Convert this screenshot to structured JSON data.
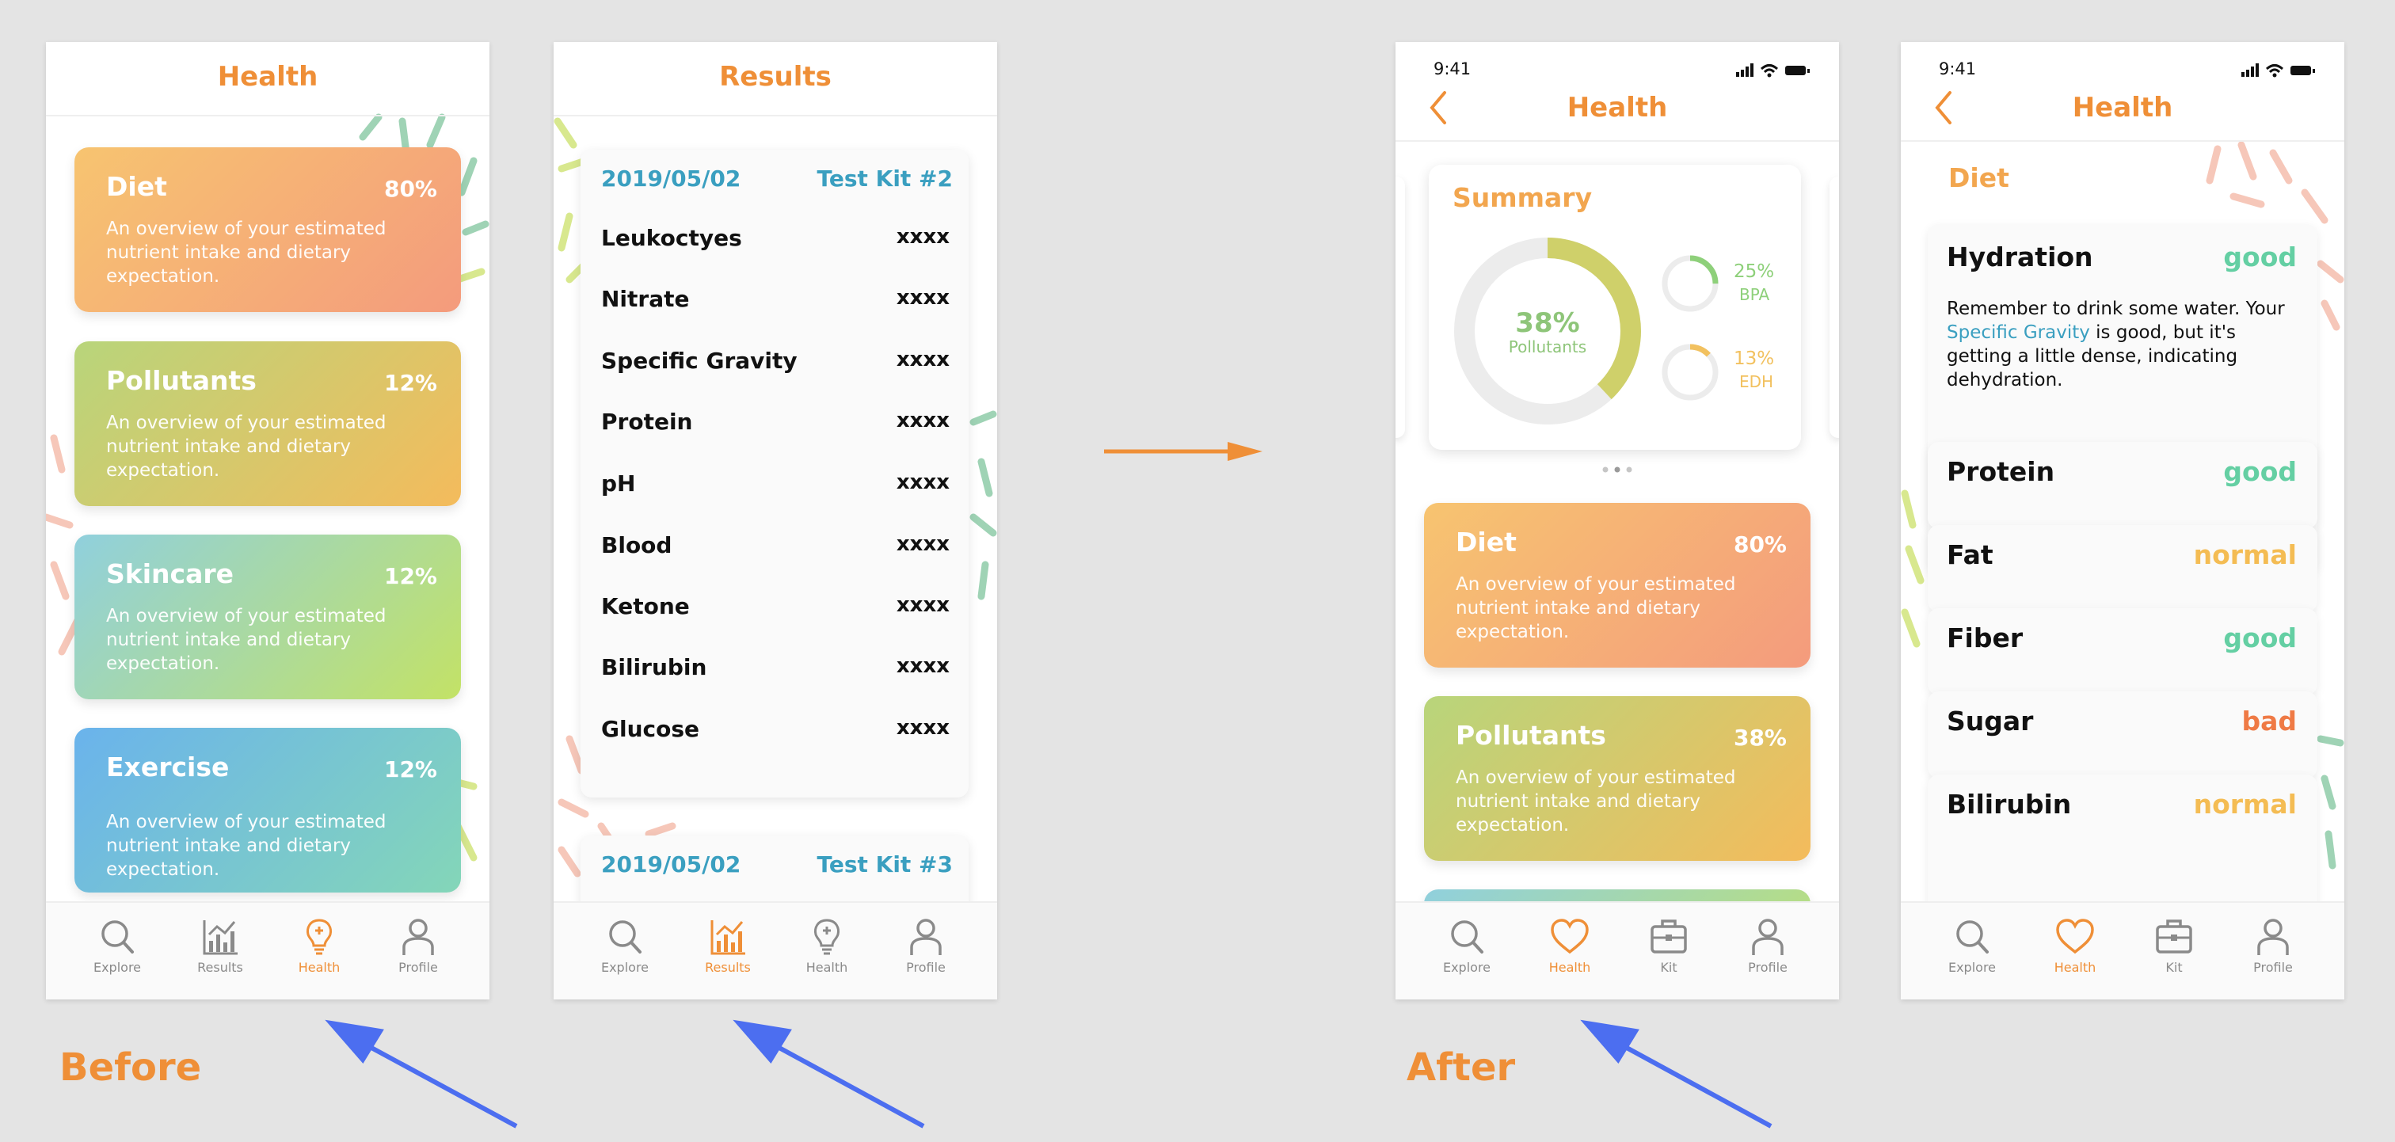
{
  "captions": {
    "before": "Before",
    "after": "After"
  },
  "colors": {
    "accent": "#ef8f37",
    "link": "#3a9fc0",
    "good": "#64cfa3",
    "normal": "#f4bc53",
    "bad": "#ef7a45",
    "arrow": "#4c6ef0"
  },
  "screen1": {
    "title": "Health",
    "cards": [
      {
        "title": "Diet",
        "percent": "80%",
        "desc": "An overview of your estimated nutrient intake and dietary expectation."
      },
      {
        "title": "Pollutants",
        "percent": "12%",
        "desc": "An overview of your estimated nutrient intake and dietary expectation."
      },
      {
        "title": "Skincare",
        "percent": "12%",
        "desc": "An overview of your estimated nutrient intake and dietary expectation."
      },
      {
        "title": "Exercise",
        "percent": "12%",
        "desc": "An overview of your estimated nutrient intake and dietary expectation."
      }
    ],
    "nav": [
      {
        "label": "Explore",
        "icon": "search-icon"
      },
      {
        "label": "Results",
        "icon": "chart-icon"
      },
      {
        "label": "Health",
        "icon": "lightbulb-icon"
      },
      {
        "label": "Profile",
        "icon": "person-icon"
      }
    ]
  },
  "screen2": {
    "title": "Results",
    "kit1": {
      "date": "2019/05/02",
      "kit": "Test Kit #2"
    },
    "rows": [
      {
        "name": "Leukoctyes",
        "value": "xxxx"
      },
      {
        "name": "Nitrate",
        "value": "xxxx"
      },
      {
        "name": "Specific Gravity",
        "value": "xxxx"
      },
      {
        "name": "Protein",
        "value": "xxxx"
      },
      {
        "name": "pH",
        "value": "xxxx"
      },
      {
        "name": "Blood",
        "value": "xxxx"
      },
      {
        "name": "Ketone",
        "value": "xxxx"
      },
      {
        "name": "Bilirubin",
        "value": "xxxx"
      },
      {
        "name": "Glucose",
        "value": "xxxx"
      }
    ],
    "kit2": {
      "date": "2019/05/02",
      "kit": "Test Kit #3"
    },
    "nav": [
      {
        "label": "Explore",
        "icon": "search-icon"
      },
      {
        "label": "Results",
        "icon": "chart-icon"
      },
      {
        "label": "Health",
        "icon": "lightbulb-icon"
      },
      {
        "label": "Profile",
        "icon": "person-icon"
      }
    ]
  },
  "screen3": {
    "time": "9:41",
    "title": "Health",
    "summary": {
      "title": "Summary",
      "main_percent": "38%",
      "main_label": "Pollutants",
      "main_fraction": 0.38,
      "small": [
        {
          "percent": "25%",
          "label": "BPA",
          "fraction": 0.25,
          "color": "#8ed07a"
        },
        {
          "percent": "13%",
          "label": "EDH",
          "fraction": 0.13,
          "color": "#f2c15f"
        }
      ]
    },
    "cards": [
      {
        "title": "Diet",
        "percent": "80%",
        "desc": "An overview of your estimated nutrient intake and dietary expectation."
      },
      {
        "title": "Pollutants",
        "percent": "38%",
        "desc": "An overview of your estimated nutrient intake and dietary expectation."
      }
    ],
    "nav": [
      {
        "label": "Explore",
        "icon": "search-icon"
      },
      {
        "label": "Health",
        "icon": "heart-icon"
      },
      {
        "label": "Kit",
        "icon": "briefcase-icon"
      },
      {
        "label": "Profile",
        "icon": "person-icon"
      }
    ]
  },
  "screen4": {
    "time": "9:41",
    "title": "Health",
    "section": "Diet",
    "hydration": {
      "name": "Hydration",
      "status": "good",
      "text_before": "Remember to drink some water. Your ",
      "link": "Specific Gravity",
      "text_after": " is good, but it's getting a little dense, indicating dehydration."
    },
    "items": [
      {
        "name": "Protein",
        "status": "good"
      },
      {
        "name": "Fat",
        "status": "normal"
      },
      {
        "name": "Fiber",
        "status": "good"
      },
      {
        "name": "Sugar",
        "status": "bad"
      },
      {
        "name": "Bilirubin",
        "status": "normal"
      }
    ],
    "nav": [
      {
        "label": "Explore",
        "icon": "search-icon"
      },
      {
        "label": "Health",
        "icon": "heart-icon"
      },
      {
        "label": "Kit",
        "icon": "briefcase-icon"
      },
      {
        "label": "Profile",
        "icon": "person-icon"
      }
    ]
  }
}
